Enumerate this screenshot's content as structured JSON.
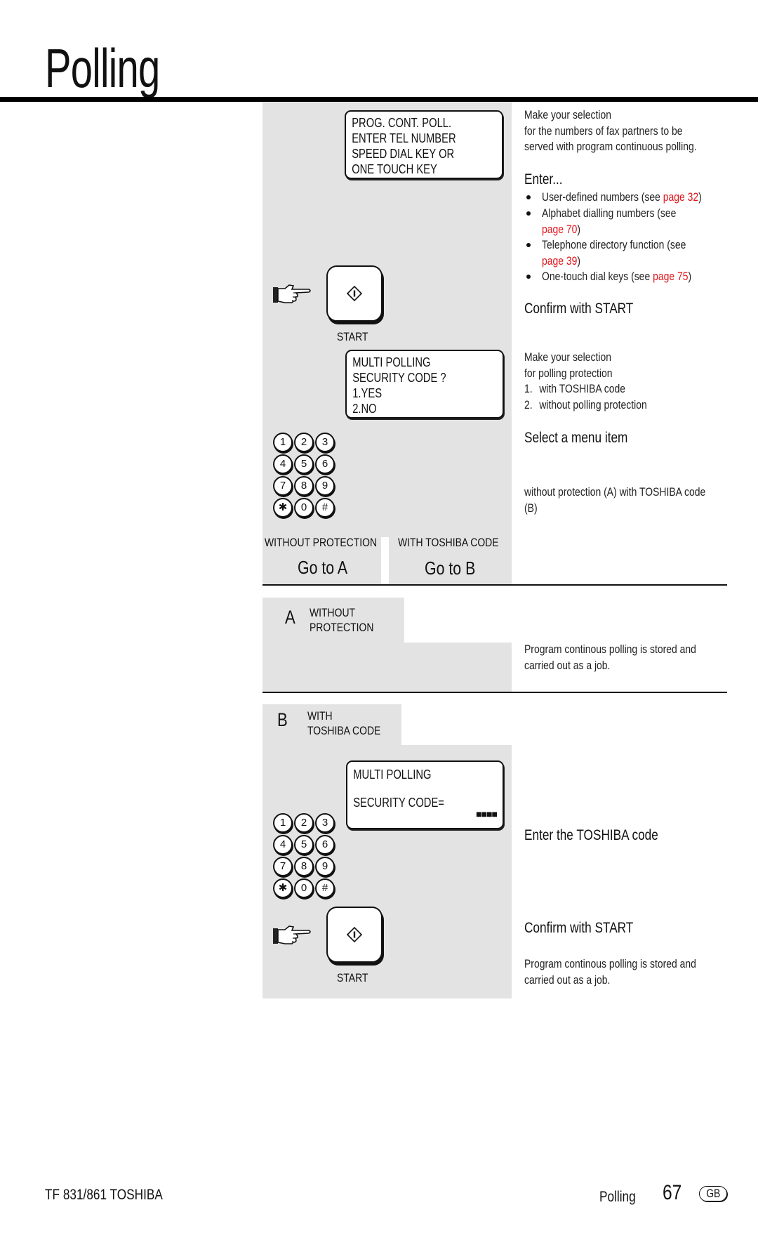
{
  "page": {
    "title": "Polling"
  },
  "step1": {
    "lcd": [
      "PROG. CONT. POLL.",
      "ENTER TEL NUMBER",
      "SPEED DIAL KEY OR",
      "ONE TOUCH KEY"
    ],
    "desc_lines": [
      "Make your selection",
      "for the numbers of fax partners to be",
      "served with program continuous polling."
    ],
    "enter_heading": "Enter...",
    "bullets": [
      {
        "text": "User-defined numbers (see ",
        "link": "page 32",
        "after": ")"
      },
      {
        "text": "Alphabet dialling numbers (see",
        "link": "page 70",
        "after": ")"
      },
      {
        "text": "Telephone directory function (see",
        "link": "page 39",
        "after": ")"
      },
      {
        "text": "One-touch dial keys (see ",
        "link": "page 75",
        "after": ")"
      }
    ],
    "confirm_heading": "Confirm with START",
    "start_label": "START",
    "start_icon": "start-diamond-icon",
    "hand_icon": "pointing-hand-icon"
  },
  "step2": {
    "lcd": [
      "MULTI POLLING",
      "SECURITY CODE ?",
      "1.YES",
      "2.NO"
    ],
    "desc_lines": [
      "Make your selection",
      "for polling protection"
    ],
    "options": [
      {
        "num": "1.",
        "text": "with TOSHIBA code"
      },
      {
        "num": "2.",
        "text": "without polling protection"
      }
    ],
    "select_heading": "Select a menu item",
    "note": "without protection (A) with TOSHIBA code",
    "note_line2": "(B)",
    "keypad": [
      "1",
      "2",
      "3",
      "4",
      "5",
      "6",
      "7",
      "8",
      "9",
      "✱",
      "0",
      "#"
    ],
    "branch_a": {
      "label": "WITHOUT PROTECTION",
      "goto": "Go to A"
    },
    "branch_b": {
      "label": "WITH TOSHIBA CODE",
      "goto": "Go to B"
    }
  },
  "section_a": {
    "letter": "A",
    "title_lines": [
      "WITHOUT",
      "PROTECTION"
    ],
    "desc_lines": [
      "Program continous polling is stored and",
      "carried out as a job."
    ]
  },
  "section_b": {
    "letter": "B",
    "title_lines": [
      "WITH",
      "TOSHIBA CODE"
    ],
    "lcd": [
      "MULTI POLLING",
      "SECURITY CODE="
    ],
    "code_mask": "■■■■",
    "keypad": [
      "1",
      "2",
      "3",
      "4",
      "5",
      "6",
      "7",
      "8",
      "9",
      "✱",
      "0",
      "#"
    ],
    "enter_heading": "Enter the TOSHIBA code",
    "confirm_heading": "Confirm with START",
    "start_label": "START",
    "desc_lines": [
      "Program continous polling is stored and",
      "carried out as a job."
    ]
  },
  "footer": {
    "model": "TF 831/861 TOSHIBA",
    "section": "Polling",
    "page_number": "67",
    "lang_badge": "GB"
  },
  "colors": {
    "link": "#e0151b",
    "panel_gray": "#e3e3e3"
  }
}
